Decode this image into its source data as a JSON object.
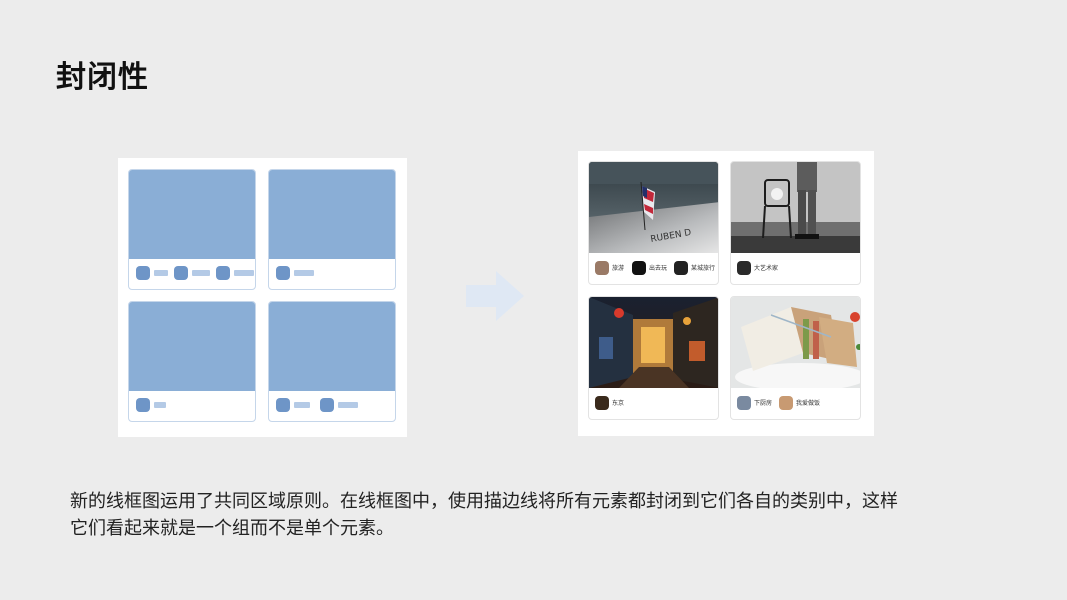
{
  "slide": {
    "title": "封闭性",
    "description_line1": "新的线框图运用了共同区域原则。在线框图中，使用描边线将所有元素都封闭到它们各自的类别中，这样",
    "description_line2": "它们看起来就是一个组而不是单个元素。"
  },
  "colors": {
    "background": "#ececec",
    "wire_image": "#8aaed6",
    "wire_dot": "#6e95c7",
    "wire_bar": "#b4cae6",
    "arrow": "#dfe8f4"
  },
  "icons": {
    "arrow": "right-arrow-icon"
  },
  "cards": [
    {
      "tags": [
        "旅游",
        "出去玩",
        "某城旅行"
      ],
      "image": "memorial-flag-photo"
    },
    {
      "tags": [
        "大艺术家"
      ],
      "image": "soldier-chair-bw-photo"
    },
    {
      "tags": [
        "东京"
      ],
      "image": "tokyo-alley-night-photo"
    },
    {
      "tags": [
        "下厨房",
        "我爱做饭"
      ],
      "image": "sandwich-photo"
    }
  ]
}
